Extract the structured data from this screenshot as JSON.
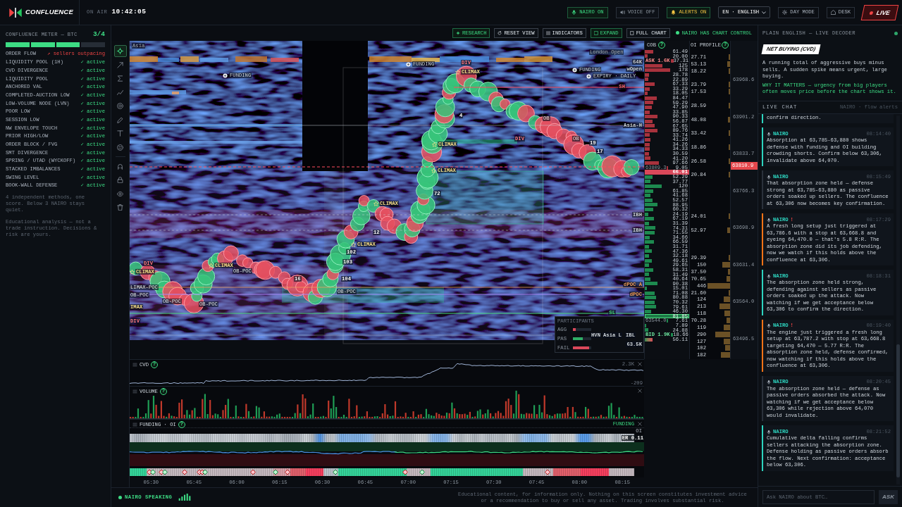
{
  "top_bar": {
    "logo": "CONFLUENCE",
    "on_air": "ON AIR",
    "clock": "10:42:05",
    "toggles": [
      {
        "label": "NAIRO ON",
        "kind": "nairo",
        "on": true
      },
      {
        "label": "VOICE OFF",
        "kind": "voice",
        "on": false
      },
      {
        "label": "ALERTS ON",
        "kind": "alerts",
        "on": true
      }
    ],
    "language": "EN · ENGLISH",
    "buttons": [
      {
        "label": "DAY MODE",
        "kind": "theme"
      },
      {
        "label": "DESK",
        "kind": "desk"
      }
    ],
    "live": "LIVE"
  },
  "meter": {
    "title": "CONFLUENCE METER — BTC",
    "score": "3/4",
    "segments": [
      {
        "on": true
      },
      {
        "on": true
      },
      {
        "on": true
      },
      {
        "on": false
      }
    ],
    "methods": [
      {
        "name": "ORDER FLOW",
        "status": "↗ sellers outpacing",
        "alert": true
      },
      {
        "name": "LIQUIDITY POOL (1H)",
        "status": "✓ active",
        "alert": false
      },
      {
        "name": "CVD DIVERGENCE",
        "status": "✓ active",
        "alert": false
      },
      {
        "name": "LIQUIDITY POOL",
        "status": "✓ active",
        "alert": false
      },
      {
        "name": "ANCHORED VAL",
        "status": "✓ active",
        "alert": false
      },
      {
        "name": "COMPLETED-AUCTION LOW",
        "status": "✓ active",
        "alert": false
      },
      {
        "name": "LOW-VOLUME NODE (LVN)",
        "status": "✓ active",
        "alert": false
      },
      {
        "name": "POOR LOW",
        "status": "✓ active",
        "alert": false
      },
      {
        "name": "SESSION LOW",
        "status": "✓ active",
        "alert": false
      },
      {
        "name": "NW ENVELOPE TOUCH",
        "status": "✓ active",
        "alert": false
      },
      {
        "name": "PRIOR HIGH/LOW",
        "status": "✓ active",
        "alert": false
      },
      {
        "name": "ORDER BLOCK / FVG",
        "status": "✓ active",
        "alert": false
      },
      {
        "name": "SMT DIVERGENCE",
        "status": "✓ active",
        "alert": false
      },
      {
        "name": "SPRING / UTAD (WYCKOFF)",
        "status": "✓ active",
        "alert": false
      },
      {
        "name": "STACKED IMBALANCES",
        "status": "✓ active",
        "alert": false
      },
      {
        "name": "SWING LEVEL",
        "status": "✓ active",
        "alert": false
      },
      {
        "name": "BOOK-WALL DEFENSE",
        "status": "✓ active",
        "alert": false
      }
    ],
    "notes": [
      "4 independent methods, one score. Below 3 NAIRO stays quiet.",
      "Educational analysis — not a trade instruction. Decisions & risk are yours."
    ]
  },
  "chart_toolbar": {
    "buttons": [
      {
        "label": "RESEARCH",
        "kind": "research",
        "accent": true
      },
      {
        "label": "RESET VIEW",
        "kind": "reset",
        "accent": false
      },
      {
        "label": "INDICATORS",
        "kind": "indicators",
        "accent": false
      },
      {
        "label": "EXPAND",
        "kind": "expand",
        "accent": true
      },
      {
        "label": "FULL CHART",
        "kind": "full",
        "accent": false
      }
    ],
    "control_status": "NAIRO HAS CHART CONTROL"
  },
  "drawing_tools": [
    {
      "kind": "crosshair",
      "selected": true
    },
    {
      "kind": "ray",
      "selected": false
    },
    {
      "kind": "sigma",
      "selected": false
    },
    {
      "kind": "trend",
      "selected": false
    },
    {
      "kind": "target",
      "selected": false
    },
    {
      "kind": "pencil",
      "selected": false
    },
    {
      "kind": "text",
      "selected": false
    },
    {
      "kind": "emoji",
      "selected": false
    },
    {
      "kind": "magnet",
      "selected": false
    },
    {
      "kind": "lock",
      "selected": false
    },
    {
      "kind": "eye",
      "selected": false
    },
    {
      "kind": "trash",
      "selected": false
    }
  ],
  "main_chart": {
    "markers": [
      {
        "label": "Asia",
        "kind": "session"
      },
      {
        "label": "London Open",
        "kind": "session"
      },
      {
        "label": "FUNDING",
        "kind": "funding"
      },
      {
        "label": "FUNDING",
        "kind": "funding"
      },
      {
        "label": "FUNDING",
        "kind": "funding"
      },
      {
        "label": "EXPIRY · DAILY",
        "kind": "funding"
      }
    ],
    "events": [
      {
        "label": "DIV",
        "kind": "divergence"
      },
      {
        "label": "CLIMAX",
        "kind": "climax"
      },
      {
        "label": "OB",
        "kind": "block"
      },
      {
        "label": "DIV",
        "kind": "divergence"
      },
      {
        "label": "OB",
        "kind": "block"
      },
      {
        "label": "CLIMAX",
        "kind": "climax"
      },
      {
        "label": "CLIMAX",
        "kind": "climax"
      },
      {
        "label": "CLIMAX",
        "kind": "climax"
      },
      {
        "label": "CLIMAX",
        "kind": "climax"
      },
      {
        "label": "DIV",
        "kind": "divergence"
      },
      {
        "label": "CLIMAX",
        "kind": "climax"
      },
      {
        "label": "OB-POC",
        "kind": "poc"
      },
      {
        "label": "CLIMAX",
        "kind": "climax"
      },
      {
        "label": "LIMAX-POC",
        "kind": "poc"
      },
      {
        "label": "OB-POC",
        "kind": "poc"
      },
      {
        "label": "OB-POC",
        "kind": "poc"
      },
      {
        "label": "OB-POC",
        "kind": "poc"
      },
      {
        "label": "OB-POC",
        "kind": "poc"
      },
      {
        "label": "IMAX",
        "kind": "climax_cut"
      },
      {
        "label": "DIV",
        "kind": "divergence"
      }
    ],
    "levels": [
      {
        "label": "64K",
        "kind": "neutral"
      },
      {
        "label": "wOpen",
        "kind": "neutral"
      },
      {
        "label": "SH",
        "kind": "high"
      },
      {
        "label": "Asia-H",
        "kind": "neutral"
      },
      {
        "label": "IBH",
        "kind": "neutral"
      },
      {
        "label": "IBH",
        "kind": "neutral"
      },
      {
        "label": "dPOC A",
        "kind": "poc"
      },
      {
        "label": "dPOC",
        "kind": "poc"
      },
      {
        "label": "SL",
        "kind": "low"
      },
      {
        "label": "HVN",
        "kind": "neutral"
      },
      {
        "label": "Asia L",
        "kind": "neutral"
      },
      {
        "label": "IBL",
        "kind": "neutral"
      },
      {
        "label": "63.5K",
        "kind": "neutral"
      }
    ],
    "counts": [
      "4",
      "19",
      "17",
      "72",
      "12",
      "102",
      "103",
      "16",
      "104"
    ],
    "participants": {
      "title": "PARTICIPANTS",
      "rows": [
        {
          "label": "AGG",
          "kind": "sell",
          "level": 0.15
        },
        {
          "label": "PAS",
          "kind": "buy",
          "level": 0.55
        },
        {
          "label": "FAIL",
          "kind": "sell",
          "level": 0.9
        }
      ]
    }
  },
  "order_book": {
    "title": "COB",
    "help": "?",
    "rows": [
      {
        "value": "61.49",
        "kind": "ask"
      },
      {
        "value": "20.00",
        "kind": "ask"
      },
      {
        "value": "37.31",
        "kind": "ask",
        "tag": "ASK 1.6K"
      },
      {
        "value": "125",
        "kind": "ask"
      },
      {
        "value": "178",
        "kind": "ask"
      },
      {
        "value": "28.78",
        "kind": "ask"
      },
      {
        "value": "22.89",
        "kind": "ask"
      },
      {
        "value": "67.33",
        "kind": "ask"
      },
      {
        "value": "33.29",
        "kind": "ask"
      },
      {
        "value": "18.05",
        "kind": "ask"
      },
      {
        "value": "84.47",
        "kind": "ask"
      },
      {
        "value": "59.29",
        "kind": "ask"
      },
      {
        "value": "47.90",
        "kind": "ask"
      },
      {
        "value": "33.85",
        "kind": "ask"
      },
      {
        "value": "90.33",
        "kind": "ask"
      },
      {
        "value": "56.87",
        "kind": "ask"
      },
      {
        "value": "67.65",
        "kind": "ask"
      },
      {
        "value": "89.76",
        "kind": "ask"
      },
      {
        "value": "33.74",
        "kind": "ask"
      },
      {
        "value": "41.26",
        "kind": "ask"
      },
      {
        "value": "34.26",
        "kind": "ask"
      },
      {
        "value": "34.33",
        "kind": "ask"
      },
      {
        "value": "30.59",
        "kind": "ask"
      },
      {
        "value": "41.20",
        "kind": "ask"
      },
      {
        "value": "97.66",
        "kind": "ask"
      },
      {
        "value": "9.05",
        "kind": "ask",
        "price": "63809.3"
      },
      {
        "value": "66.01",
        "kind": "mid"
      },
      {
        "value": "52.29",
        "kind": "bid"
      },
      {
        "value": "37.77",
        "kind": "bid"
      },
      {
        "value": "120",
        "kind": "bid"
      },
      {
        "value": "61.85",
        "kind": "bid"
      },
      {
        "value": "41.68",
        "kind": "bid"
      },
      {
        "value": "52.57",
        "kind": "bid"
      },
      {
        "value": "88.95",
        "kind": "bid"
      },
      {
        "value": "60.32",
        "kind": "bid"
      },
      {
        "value": "24.19",
        "kind": "bid"
      },
      {
        "value": "67.19",
        "kind": "bid"
      },
      {
        "value": "31.39",
        "kind": "bid"
      },
      {
        "value": "74.31",
        "kind": "bid"
      },
      {
        "value": "71.55",
        "kind": "bid"
      },
      {
        "value": "34.66",
        "kind": "bid"
      },
      {
        "value": "66.59",
        "kind": "bid"
      },
      {
        "value": "31.71",
        "kind": "bid"
      },
      {
        "value": "47.36",
        "kind": "bid"
      },
      {
        "value": "32.18",
        "kind": "bid"
      },
      {
        "value": "49.61",
        "kind": "bid"
      },
      {
        "value": "29.65",
        "kind": "bid"
      },
      {
        "value": "58.31",
        "kind": "bid"
      },
      {
        "value": "31.49",
        "kind": "bid"
      },
      {
        "value": "40.64",
        "kind": "bid"
      },
      {
        "value": "90.38",
        "kind": "bid"
      },
      {
        "value": "15.01",
        "kind": "bid"
      },
      {
        "value": "71.08",
        "kind": "bid"
      },
      {
        "value": "80.88",
        "kind": "bid"
      },
      {
        "value": "70.32",
        "kind": "bid"
      },
      {
        "value": "79.61",
        "kind": "bid"
      },
      {
        "value": "46.30",
        "kind": "bid"
      },
      {
        "value": "81.85",
        "kind": "wall"
      },
      {
        "value": "7.61",
        "kind": "bid",
        "price": "63544.0"
      },
      {
        "value": "7.89",
        "kind": "bid"
      },
      {
        "value": "24.88",
        "kind": "bid"
      },
      {
        "value": "18.66",
        "kind": "bid",
        "tag": "BID 1.9K"
      },
      {
        "value": "56.11",
        "kind": "mixed"
      }
    ]
  },
  "oi_profile": {
    "title": "OI PROFILE",
    "help": "?",
    "values": [
      "27.71",
      "53.13",
      "18.22",
      "23.79",
      "17.53",
      "28.59",
      "48.08",
      "33.42",
      "18.86",
      "26.58",
      "20.84",
      "24.01",
      "52.97",
      "29.39",
      "150",
      "37.50",
      "70.65",
      "446",
      "21.60",
      "124",
      "213",
      "118",
      "70.28",
      "119",
      "290",
      "127",
      "102",
      "182"
    ]
  },
  "price_axis": {
    "ticks": [
      "63968.6",
      "63901.2",
      "63833.7",
      "63766.3",
      "63698.9",
      "63631.4",
      "63564.0",
      "63496.5"
    ],
    "last_price": "63810.9"
  },
  "cvd_panel": {
    "title": "CVD",
    "help": "?",
    "high": "2.3K",
    "low": "-209"
  },
  "volume_panel": {
    "title": "VOLUME",
    "help": "?"
  },
  "funding_panel": {
    "title": "FUNDING · OI",
    "help": "?",
    "funding_label": "FUNDING",
    "oi_label": "OI",
    "rate": "ER 0.11"
  },
  "time_axis": [
    "05:30",
    "05:45",
    "06:00",
    "06:15",
    "06:30",
    "06:45",
    "07:00",
    "07:15",
    "07:30",
    "07:45",
    "08:00",
    "08:15"
  ],
  "footer": {
    "speaking": "NAIRO SPEAKING",
    "disclaimer": "Educational content, for information only. Nothing on this screen constitutes investment advice or a recommendation to buy or sell any asset. Trading involves substantial risk."
  },
  "decoder": {
    "title": "PLAIN ENGLISH — LIVE DECODER",
    "term": "NET BUYING (CVD)",
    "explanation": "A running total of aggressive buys minus sells. A sudden spike means urgent, large buying.",
    "why": "WHY IT MATTERS — urgency from big players often moves price before the chart shows it."
  },
  "chat": {
    "title": "LIVE CHAT",
    "subtitle": "NAIRO · flow alerts",
    "messages": [
      {
        "kind": "signal",
        "text": "confirm direction."
      },
      {
        "kind": "signal",
        "author": "NAIRO",
        "time": "08:14:40",
        "text": "Absorption at 63,785-63,880 shows defense with funding and OI building crowding shorts. Confirm below 63,306, invalidate above 64,070."
      },
      {
        "kind": "note",
        "author": "NAIRO",
        "time": "08:15:49",
        "text": "That absorption zone held — defense strong at 63,785-63,880 as passive orders soaked up sellers. The confluence at 63,306 now becomes key confirmation."
      },
      {
        "kind": "alert",
        "author": "NAIRO",
        "flag": "!",
        "time": "08:17:29",
        "text": "A fresh long setup just triggered at 63,786.6 with a stop at 63,668.8 and eyeing 64,470.0 — that's 5.8 R:R. The absorption zone did its job defending, now we watch if this holds above the confluence at 63,306."
      },
      {
        "kind": "signal",
        "author": "NAIRO",
        "time": "08:18:31",
        "text": "The absorption zone held strong, defending against sellers as passive orders soaked up the attack. Now watching if we get acceptance below 63,306 to confirm the direction."
      },
      {
        "kind": "alert",
        "author": "NAIRO",
        "flag": "!",
        "time": "08:19:40",
        "text": "The engine just triggered a fresh long setup at 63,787.2 with stop at 63,668.8 targeting 64,470 — 5.77 R:R. The absorption zone held, defense confirmed, now watching if this holds above the confluence at 63,306."
      },
      {
        "kind": "note",
        "author": "NAIRO",
        "time": "08:20:45",
        "text": "The absorption zone held — defense as passive orders absorbed the attack. Now watching if we get acceptance below 63,306 while rejection above 64,070 would invalidate."
      },
      {
        "kind": "signal",
        "author": "NAIRO",
        "time": "08:21:52",
        "text": "Cumulative delta falling confirms sellers attacking the absorption zone. Defense holding as passive orders absorb the flow. Next confirmation: acceptance below 63,306."
      }
    ],
    "input": {
      "placeholder": "Ask NAIRO about BTC…"
    },
    "send": "ASK"
  }
}
